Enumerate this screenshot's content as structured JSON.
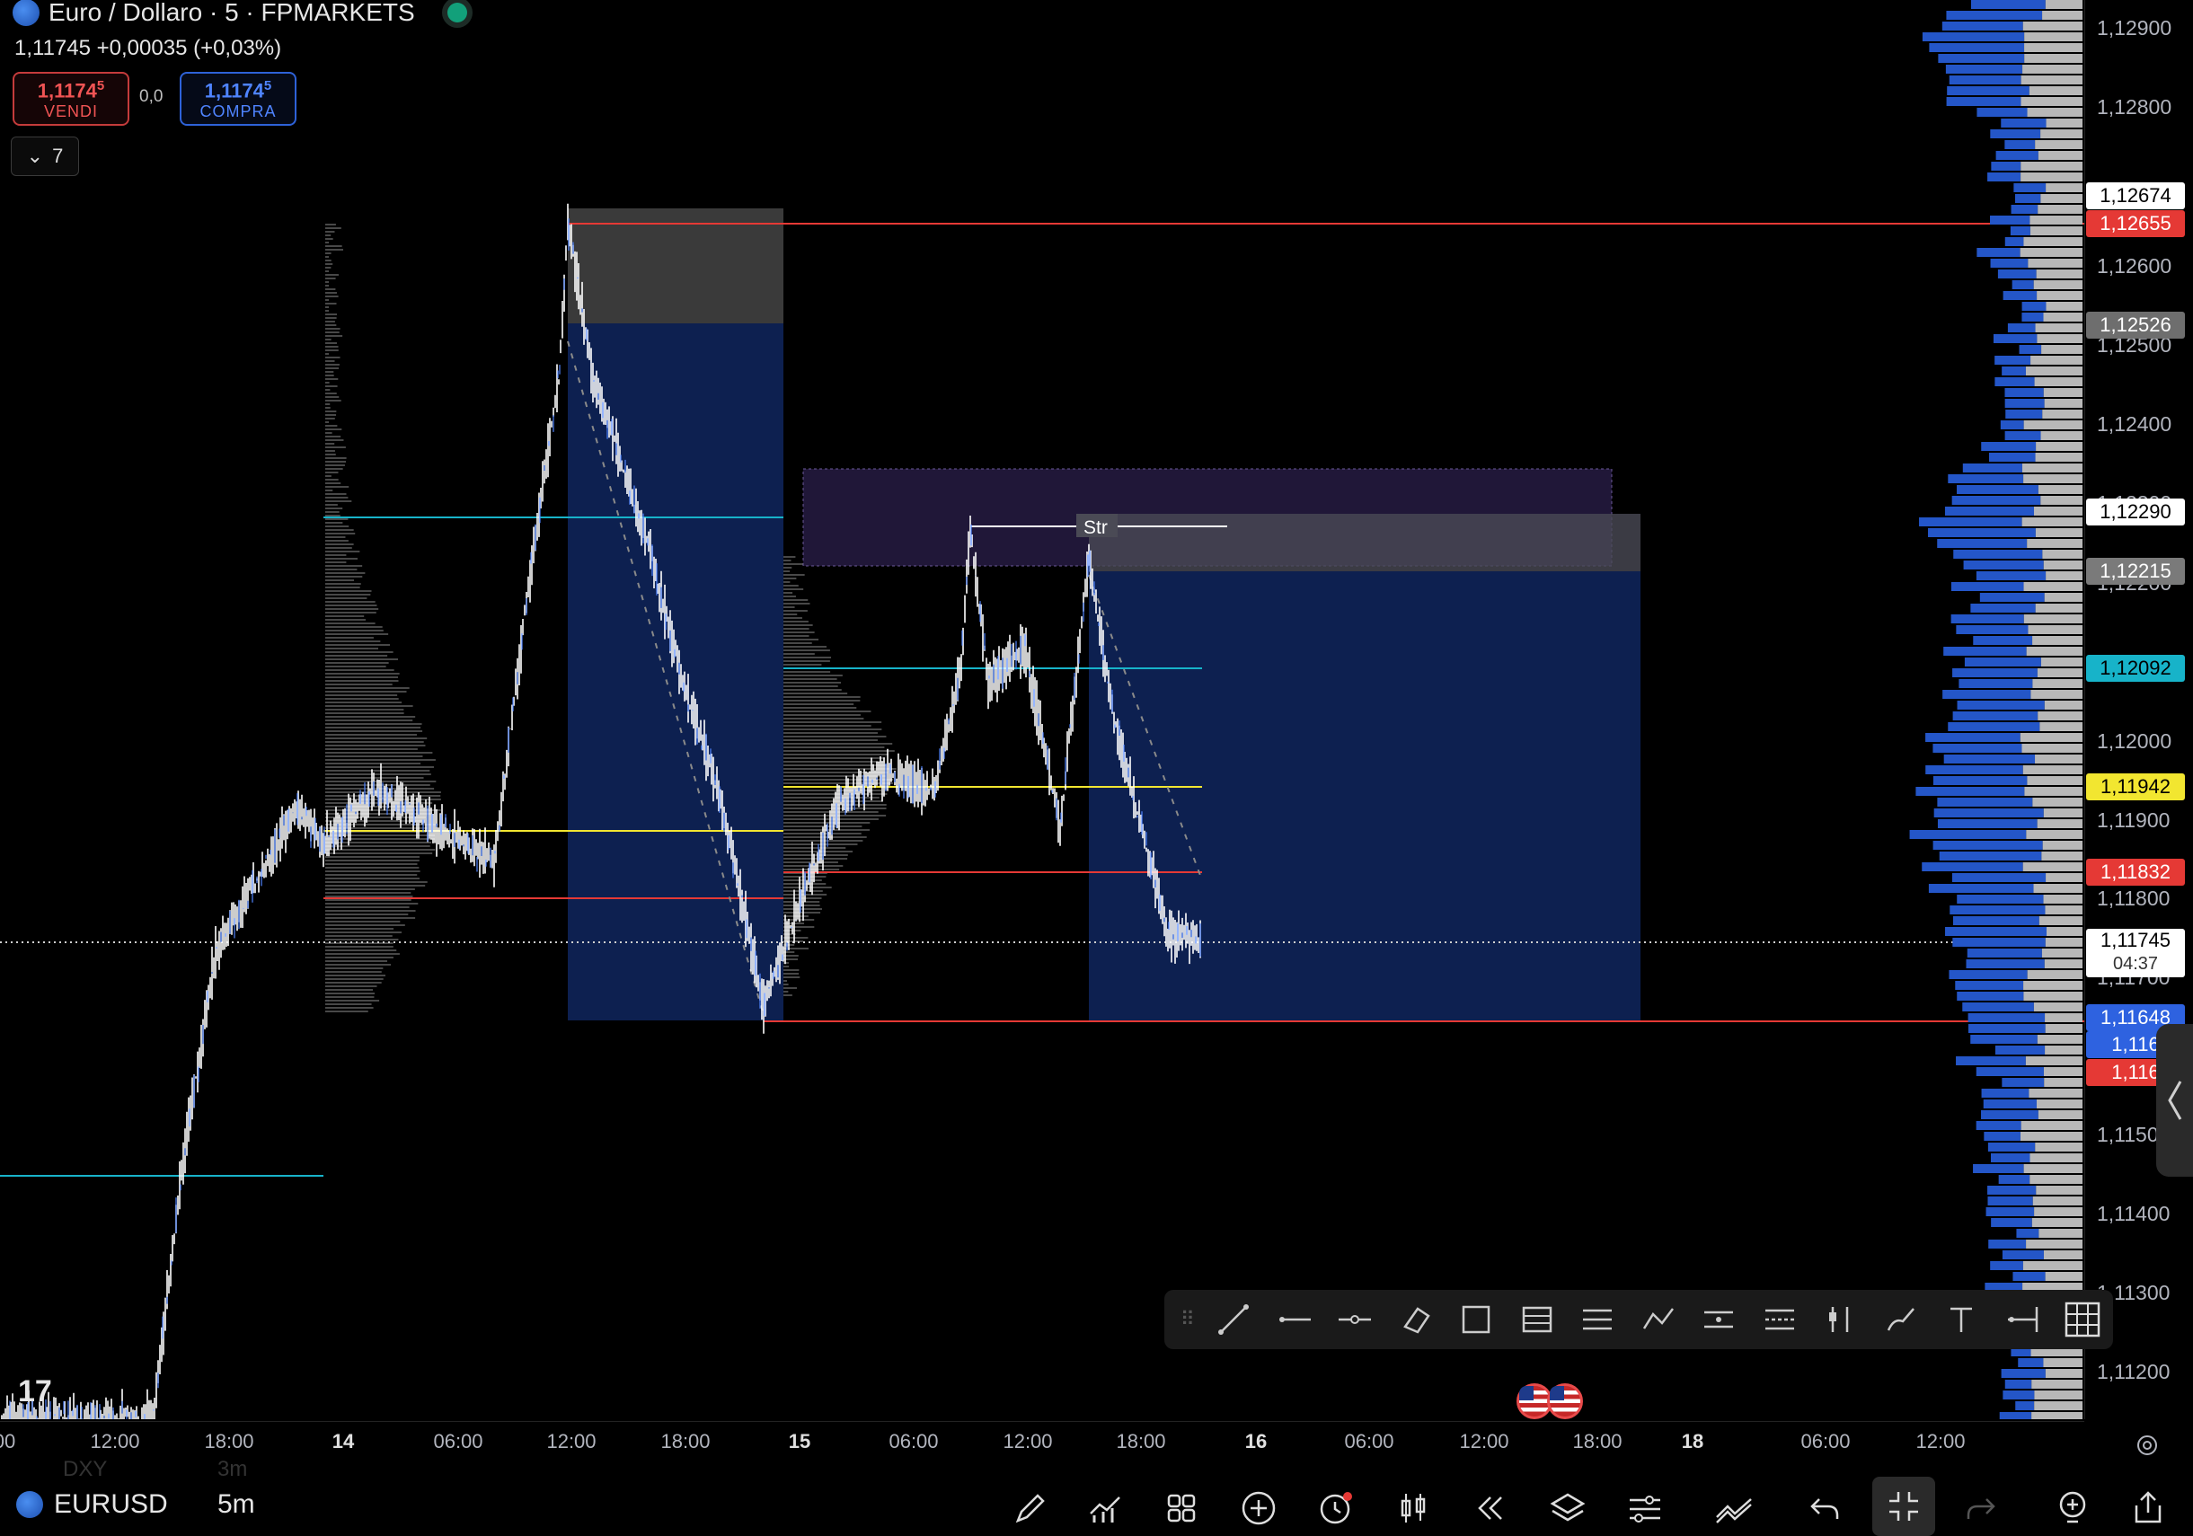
{
  "header": {
    "title": "Euro / Dollaro · 5 · FPMARKETS",
    "price_line": "1,11745  +0,00035 (+0,03%)",
    "sell": {
      "price": "1,1174",
      "price_sup": "5",
      "label": "VENDI"
    },
    "buy": {
      "price": "1,1174",
      "price_sup": "5",
      "label": "COMPRA"
    },
    "spread": "0,0",
    "collapse_count": "7"
  },
  "price_axis": {
    "ticks": [
      "1,12900",
      "1,12800",
      "1,12600",
      "1,12500",
      "1,12400",
      "1,12300",
      "1,12200",
      "1,12000",
      "1,11900",
      "1,11800",
      "1,11700",
      "1,11500",
      "1,11400",
      "1,11300",
      "1,11200"
    ],
    "tags": [
      {
        "label": "1,12674",
        "bg": "#ffffff",
        "fg": "#000000"
      },
      {
        "label": "1,12655",
        "bg": "#e53935",
        "fg": "#ffffff"
      },
      {
        "label": "1,12526",
        "bg": "#6e6e6e",
        "fg": "#ffffff"
      },
      {
        "label": "1,12290",
        "bg": "#ffffff",
        "fg": "#000000"
      },
      {
        "label": "1,12215",
        "bg": "#7a7a7a",
        "fg": "#ffffff"
      },
      {
        "label": "1,12092",
        "bg": "#17b3c9",
        "fg": "#000000"
      },
      {
        "label": "1,11942",
        "bg": "#f2e630",
        "fg": "#000000"
      },
      {
        "label": "1,11832",
        "bg": "#e53935",
        "fg": "#ffffff"
      },
      {
        "label": "1,11745",
        "bg": "#ffffff",
        "fg": "#000000"
      },
      {
        "label": "1,11648",
        "bg": "#2e62e0",
        "fg": "#ffffff"
      },
      {
        "label": "1,116",
        "bg": "#2e62e0",
        "fg": "#ffffff"
      },
      {
        "label": "1,116",
        "bg": "#e53935",
        "fg": "#ffffff"
      }
    ],
    "countdown": "04:37"
  },
  "time_axis": [
    "00",
    "12:00",
    "18:00",
    "14",
    "06:00",
    "12:00",
    "18:00",
    "15",
    "06:00",
    "12:00",
    "18:00",
    "16",
    "06:00",
    "12:00",
    "18:00",
    "18",
    "06:00",
    "12:00"
  ],
  "chart": {
    "label_str": "Str",
    "colors": {
      "red": "#e53935",
      "cyan": "#17b3c9",
      "yellow": "#f2e630",
      "blue_zone": "#0d2050",
      "gray_zone": "#3a3a3a",
      "purple_zone": "#3b2a66"
    }
  },
  "drawing_toolbar": [
    "trend-line",
    "horizontal-ray",
    "horizontal-line",
    "eraser",
    "rectangle",
    "table",
    "fib-retracement",
    "path",
    "parallel-channel",
    "regression",
    "long-position",
    "brush",
    "text",
    "arrow-marker",
    "grid"
  ],
  "bottom_bar": {
    "symbol": "EURUSD",
    "timeframe": "5m",
    "ghost_symbol": "DXY",
    "ghost_tf": "3m",
    "tools": [
      "pencil-icon",
      "indicators-icon",
      "layouts-icon",
      "add-icon",
      "alert-icon",
      "candles-icon",
      "replay-icon",
      "layers-icon",
      "settings-icon",
      "compare-icon",
      "undo-icon",
      "fullscreen-exit-icon",
      "redo-icon",
      "lightbulb-add-icon",
      "share-icon"
    ]
  }
}
